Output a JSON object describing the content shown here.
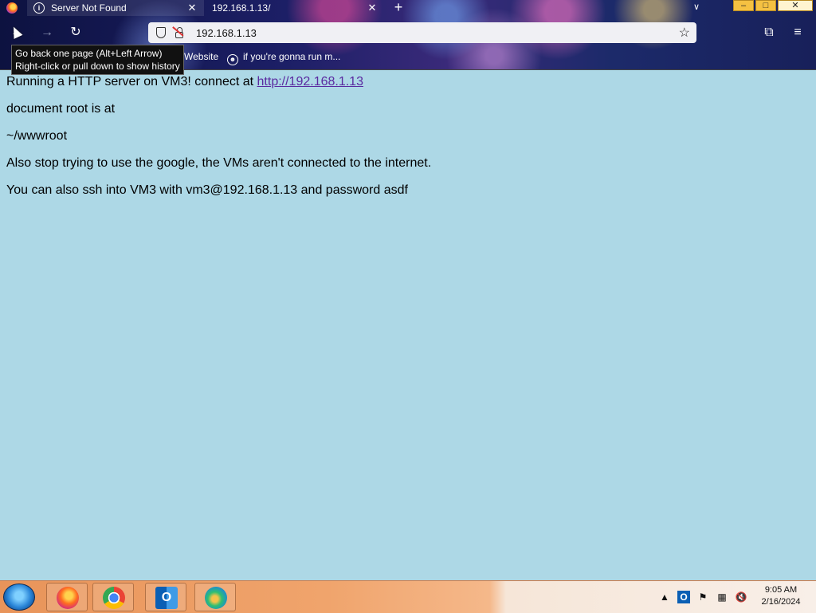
{
  "browser": {
    "tabs": [
      {
        "label": "Server Not Found",
        "active": true
      },
      {
        "label": "192.168.1.13/",
        "active": false
      }
    ],
    "new_tab_glyph": "+",
    "list_tabs_glyph": "∨",
    "url": "192.168.1.13",
    "bookmarks": [
      {
        "label": "Website"
      },
      {
        "label": "if you're gonna run m..."
      }
    ],
    "tooltip": {
      "line1": "Go back one page (Alt+Left Arrow)",
      "line2": "Right-click or pull down to show history"
    }
  },
  "page": {
    "line1_text": "Running a HTTP server on VM3! connect at ",
    "line1_link": "http://192.168.1.13",
    "line2": "document root is at",
    "line3": "~/wwwroot",
    "line4": "Also stop trying to use the google, the VMs aren't connected to the internet.",
    "line5": "You can also ssh into VM3 with vm3@192.168.1.13 and password asdf"
  },
  "taskbar": {
    "apps": [
      "firefox-icon",
      "chrome-icon",
      "outlook-icon",
      "edge-icon"
    ],
    "time": "9:05 AM",
    "date": "2/16/2024"
  },
  "colors": {
    "page_background": "#add8e6",
    "link": "#5a2aa0"
  }
}
